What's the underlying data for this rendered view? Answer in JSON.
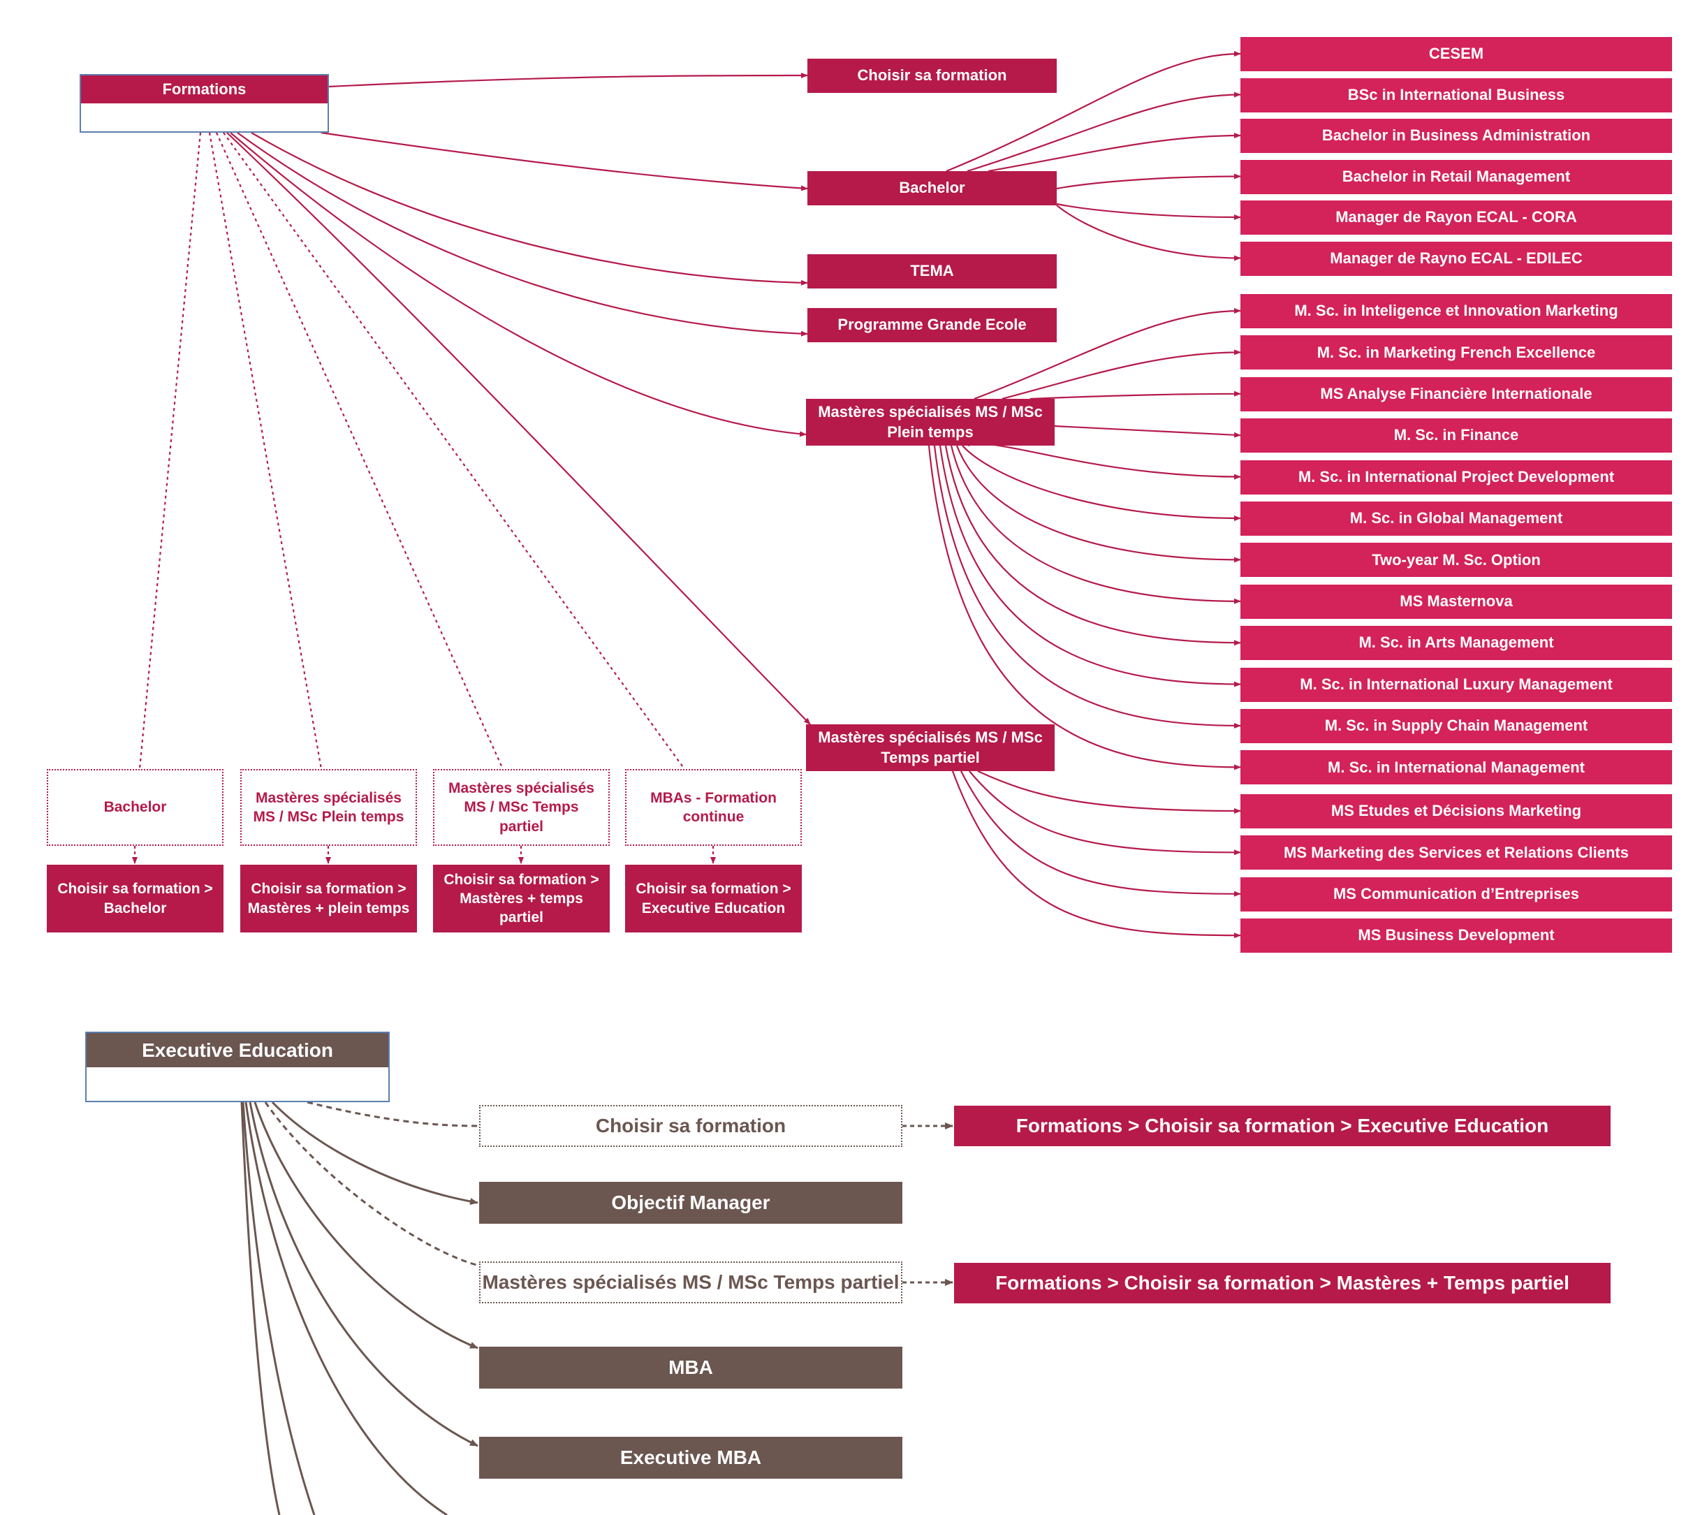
{
  "colors": {
    "crimson": "#b51a4a",
    "pink": "#d4225a",
    "brown": "#6b5650",
    "root_border": "#5a7fb0"
  },
  "formations": {
    "root_label": "Formations",
    "level1": {
      "choisir": "Choisir sa formation",
      "bachelor": "Bachelor",
      "tema": "TEMA",
      "pge": "Programme Grande Ecole",
      "ms_plein_line1": "Mastères spécialisés MS / MSc",
      "ms_plein_line2": "Plein temps",
      "ms_partiel_line1": "Mastères spécialisés MS / MSc",
      "ms_partiel_line2": "Temps partiel"
    },
    "bachelor_children": [
      "CESEM",
      "BSc in International Business",
      "Bachelor in Business Administration",
      "Bachelor in Retail Management",
      "Manager de Rayon ECAL - CORA",
      "Manager de Rayno ECAL - EDILEC"
    ],
    "ms_plein_children": [
      "M. Sc. in Inteligence et Innovation Marketing",
      "M. Sc. in Marketing French Excellence",
      "MS Analyse Financière Internationale",
      "M. Sc. in Finance",
      "M. Sc. in International Project Development",
      "M. Sc. in Global Management",
      "Two-year M. Sc. Option",
      "MS Masternova",
      "M. Sc. in Arts Management",
      "M. Sc. in International Luxury Management",
      "M. Sc. in Supply Chain Management",
      "M. Sc. in International Management"
    ],
    "ms_partiel_children": [
      "MS Etudes et Décisions Marketing",
      "MS Marketing des Services et Relations Clients",
      "MS Communication d’Entreprises",
      "MS Business Development"
    ],
    "link_boxes": [
      {
        "ref": "Bachelor",
        "target": "Choisir sa formation > Bachelor"
      },
      {
        "ref": "Mastères spécialisés MS / MSc Plein temps",
        "target": "Choisir sa formation > Mastères + plein temps"
      },
      {
        "ref": "Mastères spécialisés MS / MSc Temps partiel",
        "target": "Choisir sa formation > Mastères + temps partiel"
      },
      {
        "ref": "MBAs - Formation continue",
        "target": "Choisir sa formation > Executive Education"
      }
    ]
  },
  "executive": {
    "root_label": "Executive Education",
    "items": {
      "choisir_ref": "Choisir sa formation",
      "choisir_target": "Formations > Choisir sa formation > Executive Education",
      "objectif": "Objectif Manager",
      "ms_partiel_ref": "Mastères spécialisés MS / MSc Temps partiel",
      "ms_partiel_target": "Formations > Choisir sa formation > Mastères + Temps partiel",
      "mba": "MBA",
      "emba": "Executive MBA"
    }
  }
}
